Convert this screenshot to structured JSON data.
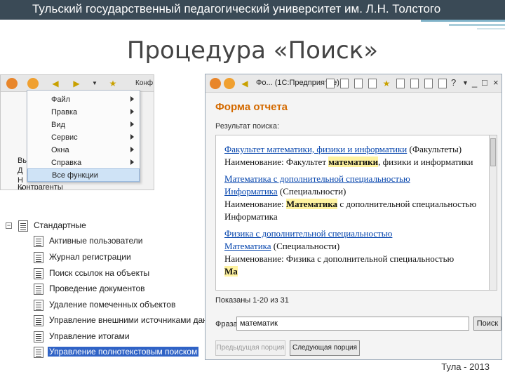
{
  "slide": {
    "header": "Тульский государственный педагогический университет им. Л.Н. Толстого",
    "title": "Процедура «Поиск»",
    "footer": "Тула - 2013",
    "colors": {
      "header_bg": "#3a4a56",
      "accent": "#7fb2c8",
      "form_heading": "#d46a00",
      "selection": "#3063c6",
      "highlight": "#fff3a0"
    }
  },
  "menu_panel": {
    "toolbar_text": "Конф",
    "left_labels": [
      "Вы",
      "Д",
      "Н",
      "И"
    ],
    "bottom_label": "Контрагенты",
    "menu_items": [
      {
        "label": "Файл",
        "has_submenu": true
      },
      {
        "label": "Правка",
        "has_submenu": true
      },
      {
        "label": "Вид",
        "has_submenu": true
      },
      {
        "label": "Сервис",
        "has_submenu": true
      },
      {
        "label": "Окна",
        "has_submenu": true
      },
      {
        "label": "Справка",
        "has_submenu": true
      },
      {
        "label": "Все функции",
        "has_submenu": false,
        "highlighted": true
      }
    ]
  },
  "tree_panel": {
    "root": "Стандартные",
    "items": [
      {
        "label": "Активные пользователи"
      },
      {
        "label": "Журнал регистрации"
      },
      {
        "label": "Поиск ссылок на объекты"
      },
      {
        "label": "Проведение документов"
      },
      {
        "label": "Удаление помеченных объектов"
      },
      {
        "label": "Управление внешними источниками дан"
      },
      {
        "label": "Управление итогами"
      },
      {
        "label": "Управление полнотекстовым поиском",
        "selected": true
      }
    ]
  },
  "report_form": {
    "window_title": "Фо... (1С:Предприятие)",
    "heading": "Форма отчета",
    "result_label": "Результат поиска:",
    "results": [
      {
        "link": "Факультет математики, физики и информатики",
        "suffix": " (Факультеты)"
      },
      {
        "prefix": "Наименование: Факультет ",
        "match": "математики",
        "suffix": ", физики и информатики"
      },
      {
        "link": "Математика с дополнительной специальностью"
      },
      {
        "link": "Информатика",
        "suffix": " (Специальности)"
      },
      {
        "prefix": "Наименование: ",
        "match": "Математика",
        "suffix": " с дополнительной специальностью"
      },
      {
        "text": "Информатика"
      },
      {
        "link": "Физика с дополнительной специальностью"
      },
      {
        "link": "Математика",
        "suffix": " (Специальности)"
      },
      {
        "text": "Наименование: Физика с дополнительной специальностью"
      },
      {
        "match": "Ма"
      }
    ],
    "shown": "Показаны 1-20 из 31",
    "phrase_label": "Фраза",
    "phrase_value": "математик",
    "search_button": "Поиск",
    "prev_button": "Предыдущая порция",
    "next_button": "Следующая порция"
  }
}
